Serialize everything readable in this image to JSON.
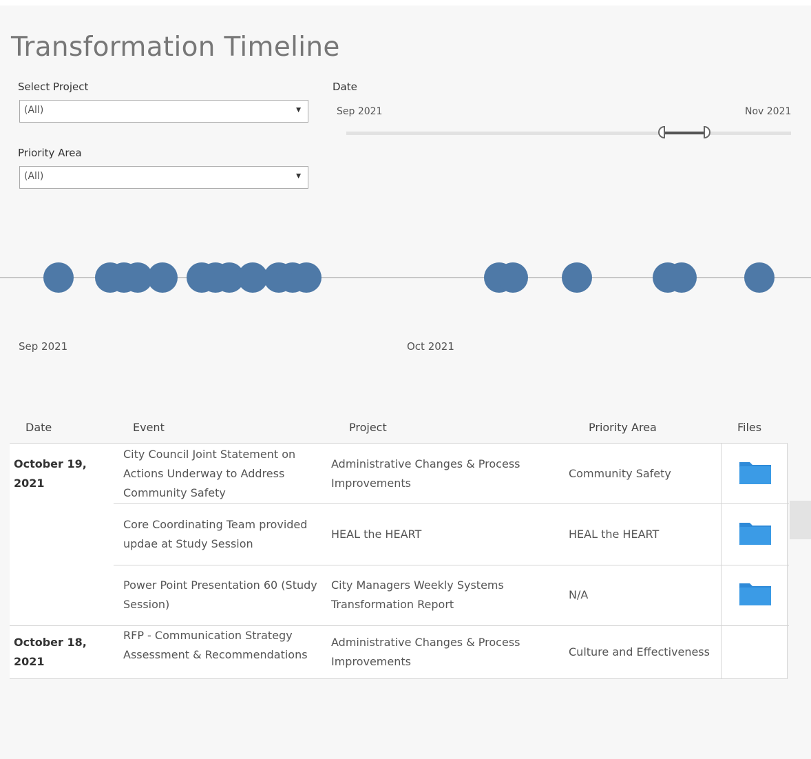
{
  "title": "Transformation Timeline",
  "filters": {
    "project": {
      "label": "Select Project",
      "value": "(All)"
    },
    "priority": {
      "label": "Priority Area",
      "value": "(All)"
    },
    "date": {
      "label": "Date",
      "start": "Sep 2021",
      "end": "Nov 2021",
      "range_start_fraction": 0.71,
      "range_end_fraction": 0.81
    }
  },
  "timeline": {
    "axis_labels": [
      "Sep 2021",
      "Oct 2021"
    ],
    "dot_color": "#4e79a7"
  },
  "table": {
    "headers": {
      "date": "Date",
      "event": "Event",
      "project": "Project",
      "priority": "Priority Area",
      "files": "Files"
    },
    "rows": [
      {
        "date": "October 19, 2021",
        "event": "City Council Joint Statement on Actions Underway to Address Community Safety",
        "project": "Administrative Changes & Process Improvements",
        "priority": "Community Safety",
        "file_icon": "folder-icon"
      },
      {
        "date": "",
        "event": "Core Coordinating Team provided updae at Study Session",
        "project": "HEAL the HEART",
        "priority": "HEAL the HEART",
        "file_icon": "folder-icon"
      },
      {
        "date": "",
        "event": "Power Point Presentation 60 (Study Session)",
        "project": "City Managers Weekly Systems Transformation Report",
        "priority": "N/A",
        "file_icon": "folder-icon"
      },
      {
        "date": "October 18, 2021",
        "event": "RFP - Communication Strategy Assessment & Recommendations",
        "project": "Administrative Changes & Process Improvements",
        "priority": "Culture and Effectiveness",
        "file_icon": ""
      }
    ]
  },
  "colors": {
    "folder": "#2e8ad8",
    "dot": "#4e79a7"
  }
}
